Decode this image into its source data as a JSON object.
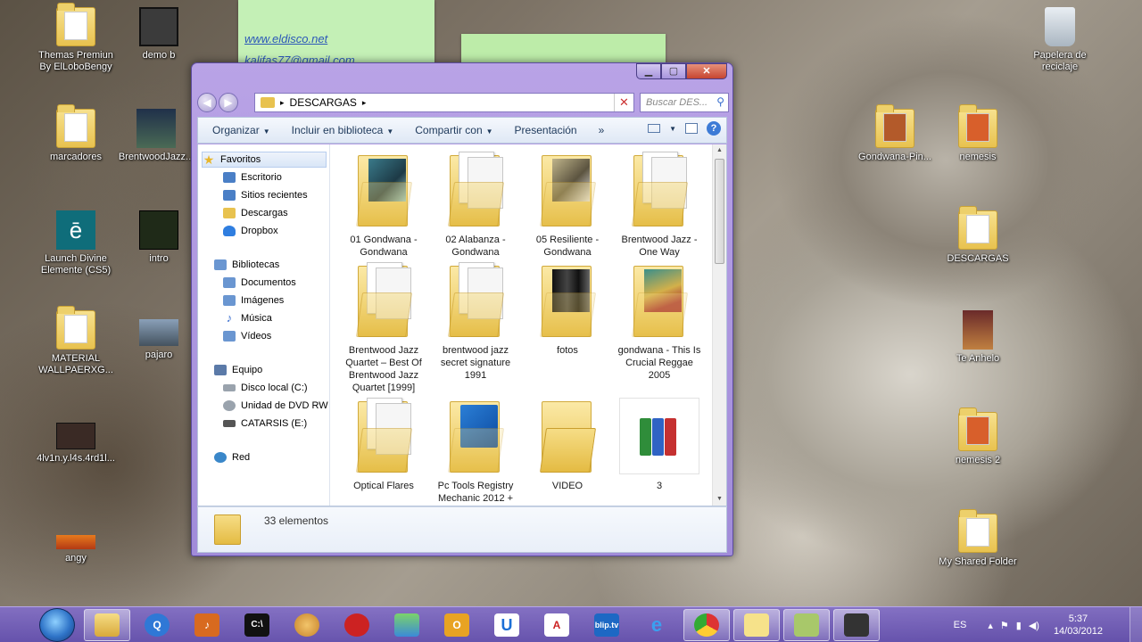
{
  "sticky_notes": {
    "note1": {
      "link": "www.eldisco.net",
      "email": "kalifas77@gmail.com"
    }
  },
  "desktop_left": [
    {
      "label": "Themas Premiun By ElLoboBengy",
      "type": "folder"
    },
    {
      "label": "demo b",
      "type": "video"
    },
    {
      "label": "marcadores",
      "type": "folder"
    },
    {
      "label": "BrentwoodJazz...",
      "type": "image"
    },
    {
      "label": "Launch Divine Elemente (CS5)",
      "type": "app"
    },
    {
      "label": "intro",
      "type": "video"
    },
    {
      "label": "MATERIAL WALLPAERXG...",
      "type": "folder"
    },
    {
      "label": "pajaro",
      "type": "image"
    },
    {
      "label": "4lv1n.y.l4s.4rd1l...",
      "type": "video"
    },
    {
      "label": "angy",
      "type": "image"
    }
  ],
  "desktop_right": [
    {
      "label": "Papelera de reciclaje",
      "type": "recycle-bin"
    },
    {
      "label": "Gondwana-Pin...",
      "type": "folder"
    },
    {
      "label": "nemesis",
      "type": "folder"
    },
    {
      "label": "DESCARGAS",
      "type": "folder"
    },
    {
      "label": "Te Anhelo",
      "type": "image"
    },
    {
      "label": "nemesis 2",
      "type": "folder"
    },
    {
      "label": "My Shared Folder",
      "type": "folder"
    }
  ],
  "explorer": {
    "breadcrumb": "DESCARGAS",
    "breadcrumb_sep": "▸",
    "search_placeholder": "Buscar DES...",
    "toolbar": {
      "organize": "Organizar",
      "include": "Incluir en biblioteca",
      "share": "Compartir con",
      "presentation": "Presentación",
      "more": "»"
    },
    "nav": {
      "favorites": "Favoritos",
      "fav_items": [
        "Escritorio",
        "Sitios recientes",
        "Descargas",
        "Dropbox"
      ],
      "libraries": "Bibliotecas",
      "lib_items": [
        "Documentos",
        "Imágenes",
        "Música",
        "Vídeos"
      ],
      "computer": "Equipo",
      "comp_items": [
        "Disco local (C:)",
        "Unidad de DVD RW (",
        "CATARSIS (E:)"
      ],
      "network": "Red"
    },
    "files": [
      {
        "name": "01 Gondwana - Gondwana",
        "thumb": "photo-teal"
      },
      {
        "name": "02 Alabanza - Gondwana",
        "thumb": "docs"
      },
      {
        "name": "05 Resiliente - Gondwana",
        "thumb": "photo-gray"
      },
      {
        "name": "Brentwood Jazz - One Way",
        "thumb": "docs"
      },
      {
        "name": "Brentwood Jazz Quartet – Best Of Brentwood Jazz Quartet [1999]",
        "thumb": "docs"
      },
      {
        "name": "brentwood jazz secret signature 1991",
        "thumb": "docs"
      },
      {
        "name": "fotos",
        "thumb": "photo-dark"
      },
      {
        "name": "gondwana - This Is Crucial Reggae 2005",
        "thumb": "photo-green"
      },
      {
        "name": "Optical Flares",
        "thumb": "docs"
      },
      {
        "name": "Pc Tools Registry Mechanic 2012 + Tutorial",
        "thumb": "app-blue"
      },
      {
        "name": "VIDEO",
        "thumb": "empty"
      },
      {
        "name": "3",
        "thumb": "rar"
      }
    ],
    "status_count": "33 elementos"
  },
  "taskbar": {
    "language": "ES",
    "time": "5:37",
    "date": "14/03/2012",
    "items": [
      "explorer",
      "search",
      "mp3",
      "cmd",
      "paint",
      "angry-bird",
      "messenger",
      "outlook",
      "ultraedit",
      "acrobat",
      "blip.tv",
      "ie",
      "chrome",
      "sticky-notes",
      "notes-2",
      "media"
    ]
  }
}
